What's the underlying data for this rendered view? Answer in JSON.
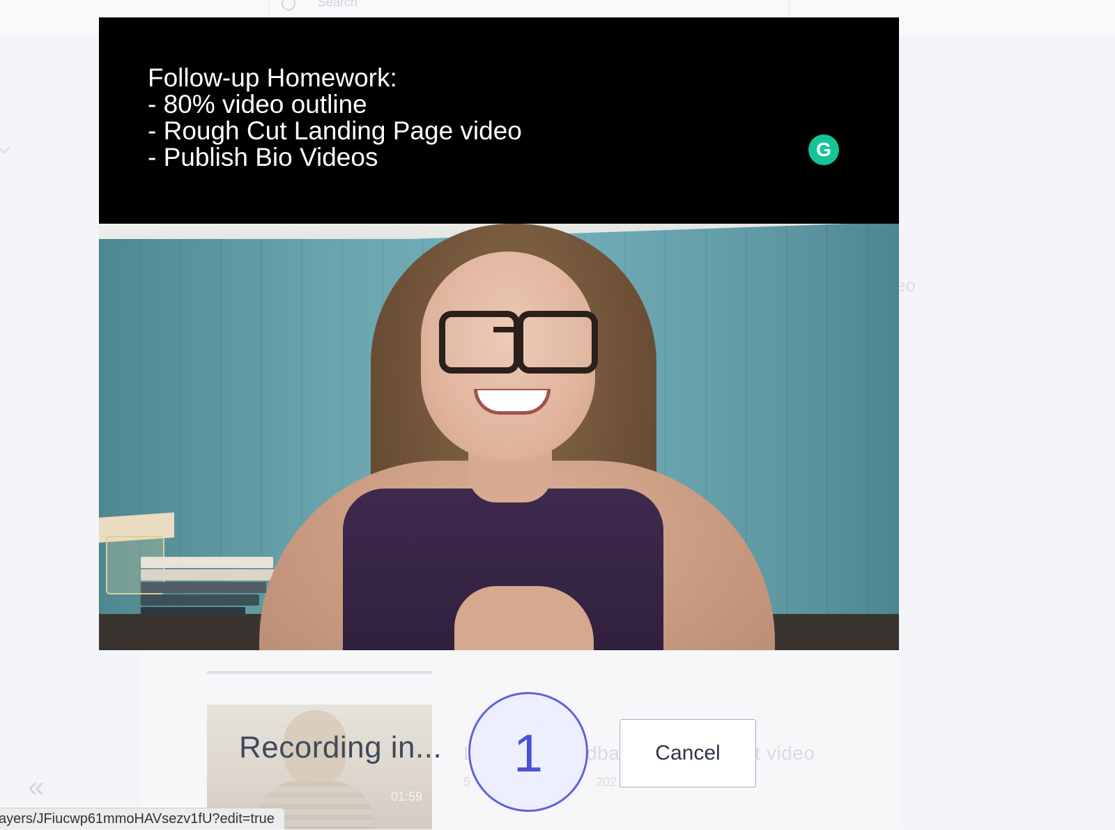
{
  "background_app": {
    "search_placeholder": "Search",
    "thumbnail_duration": "01:59",
    "video_title_fragment": "L",
    "video_title_fragment_2": "dba",
    "video_title_fragment_3": "t video",
    "date_fragment": "5",
    "date_fragment_2": "202",
    "side_text_fragment": "eo"
  },
  "teleprompter": {
    "lines": [
      "Follow-up Homework:",
      "- 80% video outline",
      "- Rough Cut Landing Page video",
      "- Publish Bio Videos"
    ],
    "grammarly_glyph": "G"
  },
  "countdown": {
    "label": "Recording in...",
    "number": "1",
    "cancel_label": "Cancel",
    "accent_color": "#5b63e0"
  },
  "status_bar": {
    "url": "ayers/JFiucwp61mmoHAVsezv1fU?edit=true"
  }
}
